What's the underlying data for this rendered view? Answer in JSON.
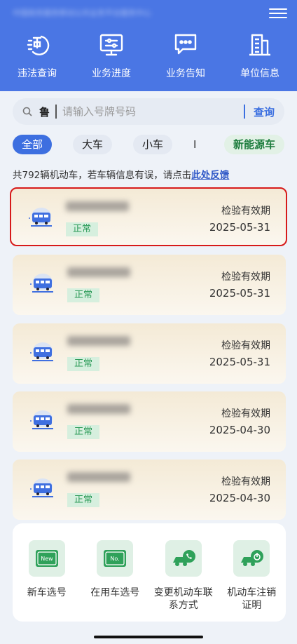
{
  "header": {
    "org_name": "中国政务服务移动公共业务平台服务中心",
    "nav": [
      {
        "label": "违法查询",
        "icon": "violation-query-icon"
      },
      {
        "label": "业务进度",
        "icon": "business-progress-icon"
      },
      {
        "label": "业务告知",
        "icon": "business-notice-icon"
      },
      {
        "label": "单位信息",
        "icon": "unit-info-icon"
      }
    ]
  },
  "search": {
    "prefix": "鲁",
    "placeholder": "请输入号牌号码",
    "button": "查询"
  },
  "filters": {
    "all": "全部",
    "big": "大车",
    "small": "小车",
    "divider": "I",
    "new_energy": "新能源车"
  },
  "summary": {
    "text": "共792辆机动车，若车辆信息有误，请点击",
    "link": "此处反馈"
  },
  "vehicles": [
    {
      "status": "正常",
      "expiry_label": "检验有效期",
      "expiry_date": "2025-05-31"
    },
    {
      "status": "正常",
      "expiry_label": "检验有效期",
      "expiry_date": "2025-05-31"
    },
    {
      "status": "正常",
      "expiry_label": "检验有效期",
      "expiry_date": "2025-05-31"
    },
    {
      "status": "正常",
      "expiry_label": "检验有效期",
      "expiry_date": "2025-04-30"
    },
    {
      "status": "正常",
      "expiry_label": "检验有效期",
      "expiry_date": "2025-04-30"
    }
  ],
  "services": [
    {
      "label": "新车选号",
      "icon": "new-plate-icon"
    },
    {
      "label": "在用车选号",
      "icon": "in-use-plate-icon"
    },
    {
      "label": "变更机动车联系方式",
      "icon": "change-contact-icon"
    },
    {
      "label": "机动车注销证明",
      "icon": "deregister-icon"
    }
  ],
  "colors": {
    "primary": "#4a76e4",
    "highlight_border": "#d71a1a",
    "status_green": "#2a9a56"
  }
}
